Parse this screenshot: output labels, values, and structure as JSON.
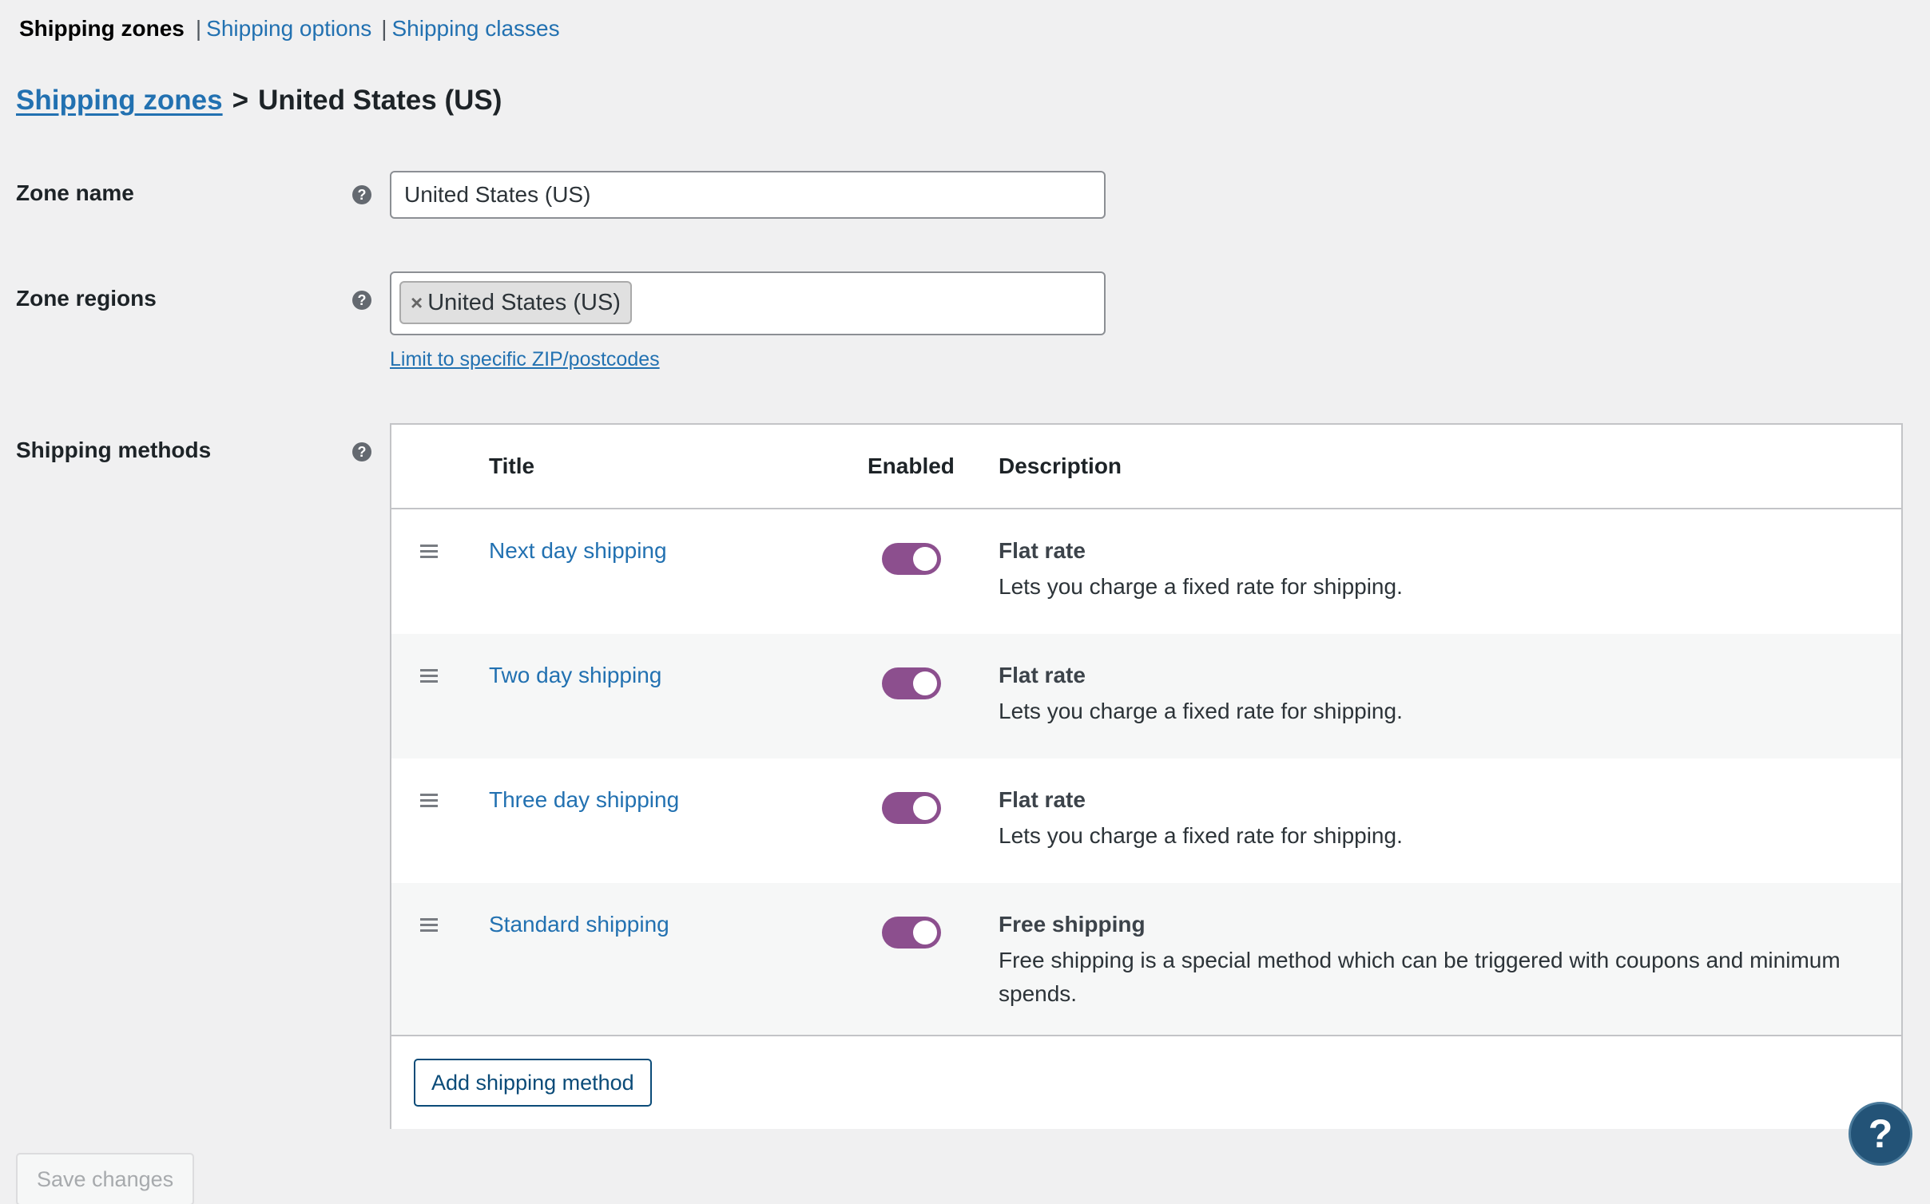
{
  "subnav": {
    "current": "Shipping zones",
    "separator": "|",
    "links": [
      "Shipping options",
      "Shipping classes"
    ]
  },
  "breadcrumb": {
    "parent": "Shipping zones",
    "separator": ">",
    "current": "United States (US)"
  },
  "zone_name": {
    "label": "Zone name",
    "value": "United States (US)"
  },
  "zone_regions": {
    "label": "Zone regions",
    "tokens": [
      "United States (US)"
    ],
    "remove_glyph": "×",
    "zip_link": "Limit to specific ZIP/postcodes"
  },
  "help_glyph": "?",
  "shipping_methods": {
    "label": "Shipping methods",
    "columns": {
      "title": "Title",
      "enabled": "Enabled",
      "description": "Description"
    },
    "rows": [
      {
        "title": "Next day shipping",
        "enabled": true,
        "desc_title": "Flat rate",
        "desc_text": "Lets you charge a fixed rate for shipping."
      },
      {
        "title": "Two day shipping",
        "enabled": true,
        "desc_title": "Flat rate",
        "desc_text": "Lets you charge a fixed rate for shipping."
      },
      {
        "title": "Three day shipping",
        "enabled": true,
        "desc_title": "Flat rate",
        "desc_text": "Lets you charge a fixed rate for shipping."
      },
      {
        "title": "Standard shipping",
        "enabled": true,
        "desc_title": "Free shipping",
        "desc_text": "Free shipping is a special method which can be triggered with coupons and minimum spends."
      }
    ],
    "add_button": "Add shipping method"
  },
  "save_button": "Save changes",
  "colors": {
    "link": "#2271b1",
    "toggle_on": "#8c4f8e",
    "background": "#f0f0f1",
    "help_fab": "#235377"
  },
  "icons": {
    "help": "question-circle-icon",
    "drag": "drag-handle-icon",
    "fab": "help-fab-icon"
  }
}
